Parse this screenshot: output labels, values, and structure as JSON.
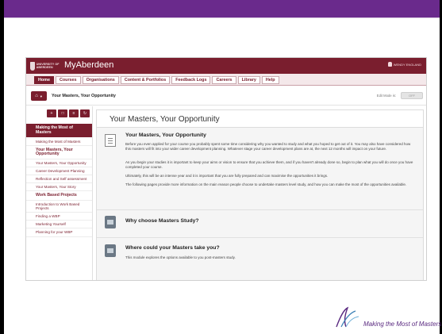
{
  "app": {
    "logo_text": "UNIVERSITY OF ABERDEEN",
    "title": "MyAberdeen",
    "user_name": "WENDY ENGLAND"
  },
  "nav": {
    "tabs": [
      "Home",
      "Courses",
      "Organisations",
      "Content & Portfolios",
      "Feedback Logs",
      "Careers",
      "Library",
      "Help"
    ],
    "active_index": 0
  },
  "course": {
    "title": "Your Masters, Your Opportunity",
    "edit_mode_label": "Edit Mode is:",
    "edit_mode_value": "OFF"
  },
  "sidebar": {
    "tool_icons": [
      "plus-icon",
      "folder-icon",
      "list-icon",
      "refresh-icon"
    ],
    "heading": "Making the Most of Masters",
    "items": [
      {
        "label": "Making the Most of Masters",
        "section": false
      },
      {
        "label": "Your Masters, Your Opportunity",
        "section": true
      },
      {
        "label": "Your Masters, Your Opportunity",
        "section": false
      },
      {
        "label": "Career Development Planning",
        "section": false
      },
      {
        "label": "Reflection and Self assessment",
        "section": false
      },
      {
        "label": "Your Masters, Your Story",
        "section": false
      },
      {
        "label": "Work Based Projects",
        "section": true
      },
      {
        "label": "Introduction to Work Based Projects",
        "section": false
      },
      {
        "label": "Finding a WBP",
        "section": false
      },
      {
        "label": "Marketing Yourself",
        "section": false
      },
      {
        "label": "Planning for your WBP",
        "section": false
      }
    ]
  },
  "content": {
    "title": "Your Masters, Your Opportunity",
    "blocks": [
      {
        "icon": "document-icon",
        "title": "Your Masters, Your Opportunity",
        "paragraphs": [
          "Before you even applied for your course you probably spent some time considering why you wanted to study and what you hoped to get out of it. You may also have considered how this masters will fit into your wider career development planning. Whatever stage your career development plans are at, the next 12 months will impact on your future.",
          "As you begin your studies it is important to keep your aims or vision to ensure that you achieve them, and if you haven't already done so, begin to plan what you will do once you have completed your course.",
          "Ultimately, this will be an intense year and it is important that you are fully prepared and can maximise the opportunities it brings.",
          "The following pages provide more information on the main reason people choose to undertake masters level study, and how you can make the most of the opportunities available."
        ]
      },
      {
        "icon": "folder-icon",
        "title": "Why choose Masters Study?",
        "paragraphs": []
      },
      {
        "icon": "folder-icon",
        "title": "Where could your Masters take you?",
        "paragraphs": [
          "This module explores the options available to you post-masters study."
        ]
      }
    ]
  },
  "footer": {
    "text": "Making the Most of Masters"
  },
  "colors": {
    "frame_purple": "#6a2a8c",
    "brand_maroon": "#7a1e2e",
    "footer_purple": "#5a2a80"
  }
}
